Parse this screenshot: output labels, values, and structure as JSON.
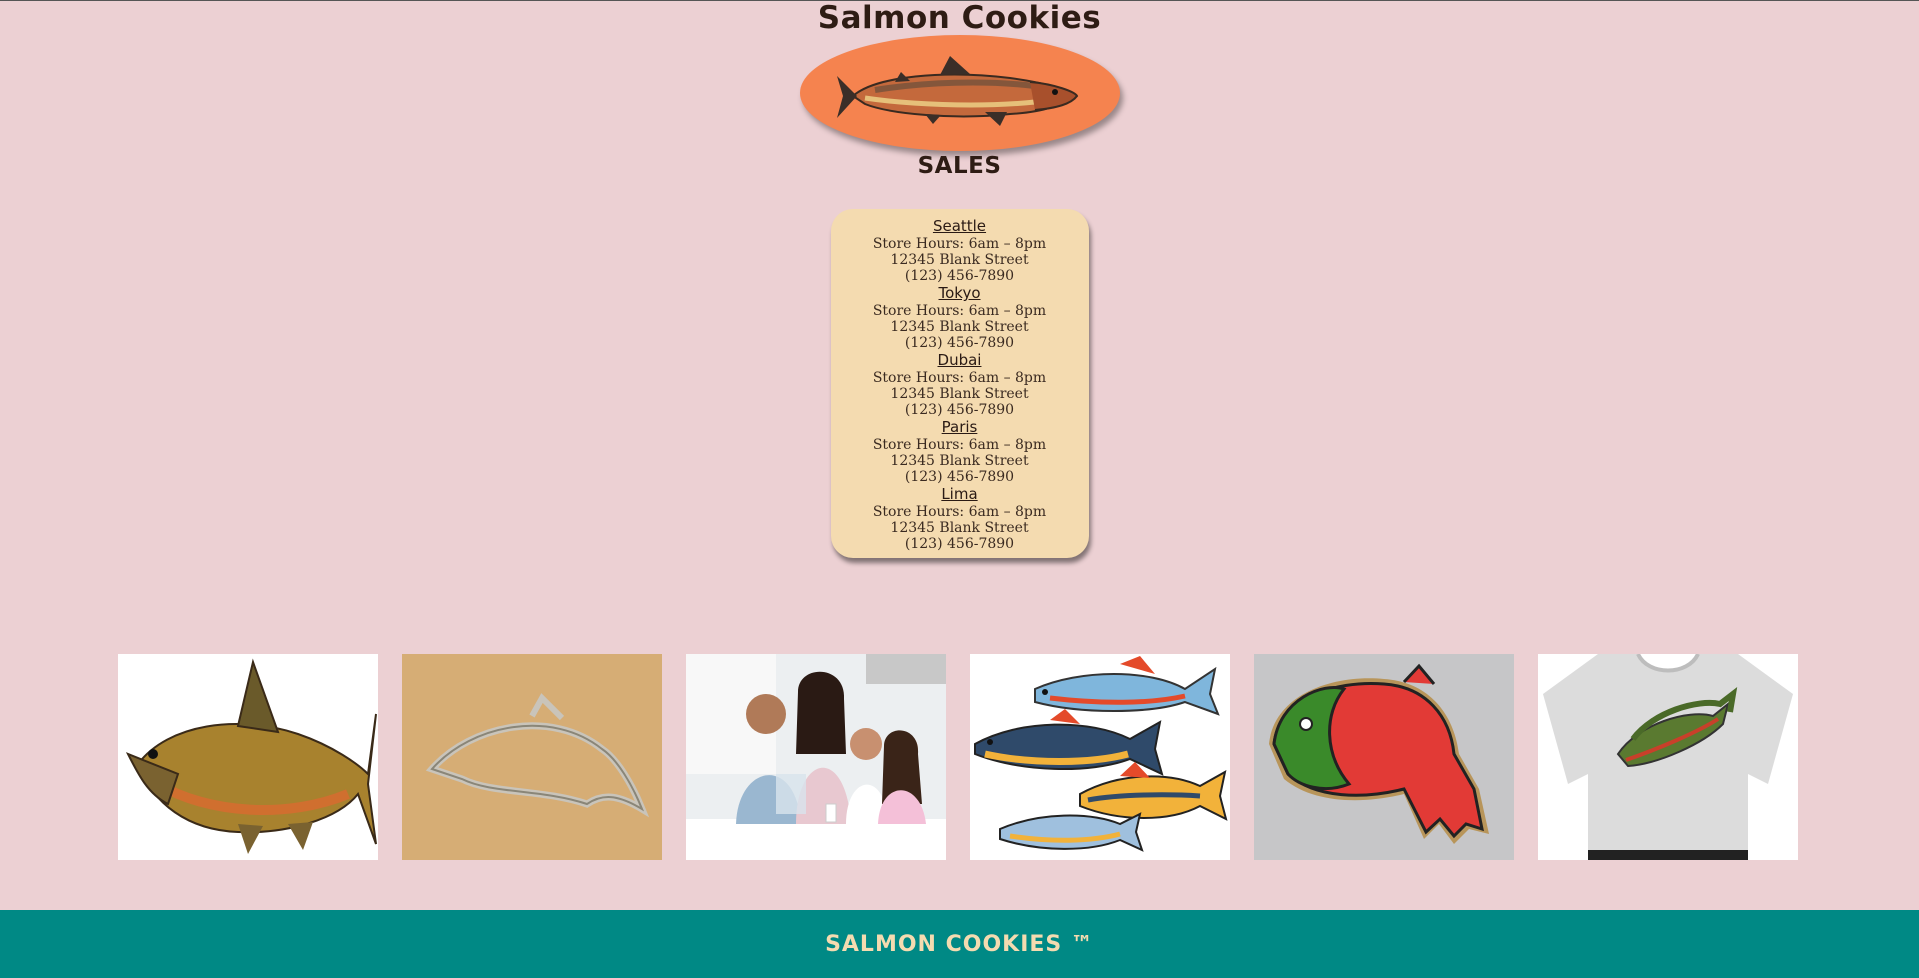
{
  "header": {
    "title": "Salmon Cookies",
    "subtitle": "SALES"
  },
  "stores": [
    {
      "name": "Seattle",
      "hours": "Store Hours: 6am – 8pm",
      "address": "12345 Blank Street",
      "phone": "(123) 456-7890"
    },
    {
      "name": "Tokyo",
      "hours": "Store Hours: 6am – 8pm",
      "address": "12345 Blank Street",
      "phone": "(123) 456-7890"
    },
    {
      "name": "Dubai",
      "hours": "Store Hours: 6am – 8pm",
      "address": "12345 Blank Street",
      "phone": "(123) 456-7890"
    },
    {
      "name": "Paris",
      "hours": "Store Hours: 6am – 8pm",
      "address": "12345 Blank Street",
      "phone": "(123) 456-7890"
    },
    {
      "name": "Lima",
      "hours": "Store Hours: 6am – 8pm",
      "address": "12345 Blank Street",
      "phone": "(123) 456-7890"
    }
  ],
  "gallery": [
    {
      "subject": "salmon-illustration"
    },
    {
      "subject": "fish-cookie-cutter"
    },
    {
      "subject": "family-with-cookies"
    },
    {
      "subject": "fish-cookies-set"
    },
    {
      "subject": "iced-salmon-cookie"
    },
    {
      "subject": "salmon-tshirt"
    }
  ],
  "footer": {
    "text": "SALMON COOKIES ™"
  },
  "colors": {
    "background": "#ecd0d3",
    "logo_oval": "#f5834f",
    "store_card": "#f4dbb0",
    "footer": "#008985",
    "footer_text": "#f4dbb0"
  }
}
